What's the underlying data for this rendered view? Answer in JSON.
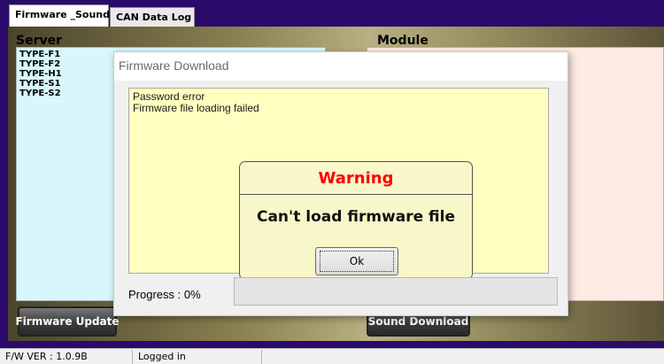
{
  "tabs": [
    {
      "label": "Firmware _Sound",
      "active": true
    },
    {
      "label": "CAN Data Log",
      "active": false
    }
  ],
  "server": {
    "header": "Server",
    "items": [
      "TYPE-F1",
      "TYPE-F2",
      "TYPE-H1",
      "TYPE-S1",
      "TYPE-S2"
    ]
  },
  "module": {
    "header": "Module"
  },
  "buttons": {
    "firmware_update": "Firmware Update",
    "sound_download": "Sound Download"
  },
  "status": {
    "version": "F/W VER : 1.0.9B",
    "login": "Logged in"
  },
  "dialog": {
    "title": "Firmware Download",
    "log": [
      "Password error",
      "Firmware file loading failed"
    ],
    "progress_label": "Progress : 0%",
    "progress_value": 0,
    "warning": {
      "title": "Warning",
      "message": "Can't load firmware file",
      "ok": "Ok"
    }
  },
  "colors": {
    "warning_title": "#ff0000",
    "server_bg": "#d8f7fc",
    "module_bg": "#fdeae2",
    "log_bg": "#ffffc0"
  }
}
